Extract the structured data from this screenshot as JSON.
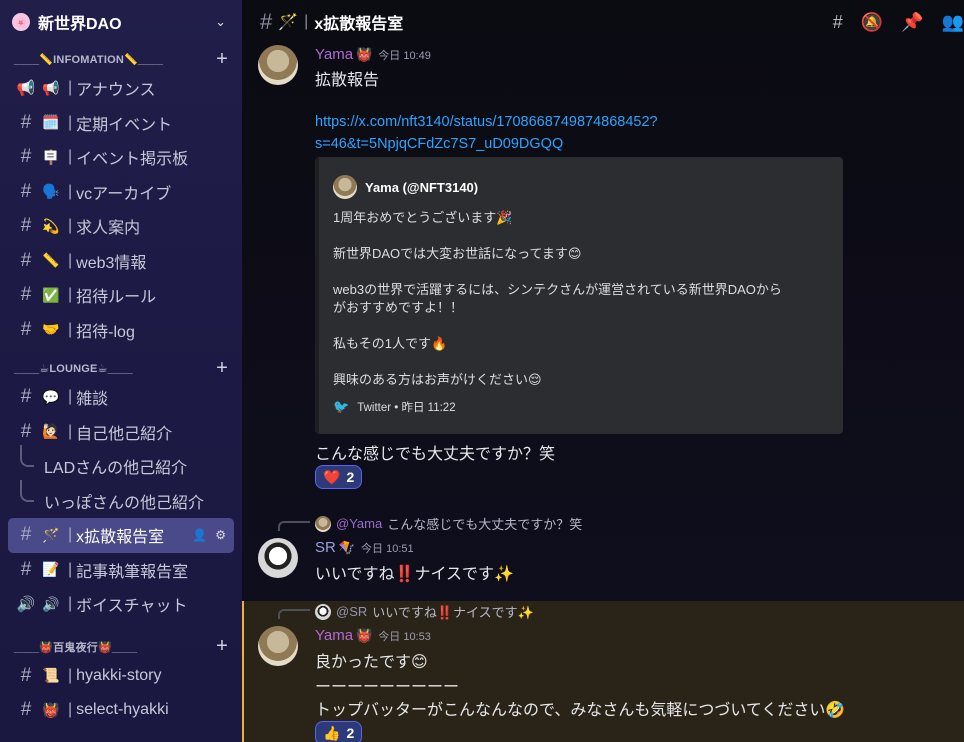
{
  "server": {
    "name": "新世界DAO",
    "icon": "🌸"
  },
  "categories": [
    {
      "label": "____📏INFOMATION📏____"
    },
    {
      "label": "____☕LOUNGE☕____"
    },
    {
      "label": "____👹百鬼夜行👹____"
    }
  ],
  "channels": {
    "info": [
      {
        "emoji": "📢",
        "name": "アナウンス",
        "icon": "announcement-icon"
      },
      {
        "emoji": "🗓️",
        "name": "定期イベント"
      },
      {
        "emoji": "🪧",
        "name": "イベント掲示板"
      },
      {
        "emoji": "🗣️",
        "name": "vcアーカイブ"
      },
      {
        "emoji": "💫",
        "name": "求人案内"
      },
      {
        "emoji": "📏",
        "name": "web3情報"
      },
      {
        "emoji": "✅",
        "name": "招待ルール"
      },
      {
        "emoji": "🤝",
        "name": "招待-log"
      }
    ],
    "lounge": [
      {
        "emoji": "💬",
        "name": "雑談"
      },
      {
        "emoji": "🙋🏻",
        "name": "自己他己紹介"
      },
      {
        "thread": "LADさんの他己紹介"
      },
      {
        "thread": "いっぽさんの他己紹介"
      },
      {
        "emoji": "🪄",
        "name": "x拡散報告室",
        "active": true
      },
      {
        "emoji": "📝",
        "name": "記事執筆報告室"
      },
      {
        "emoji": "🔊",
        "name": "ボイスチャット",
        "icon": "voice-icon"
      }
    ],
    "hyakki": [
      {
        "emoji": "📜",
        "name": "hyakki-story"
      },
      {
        "emoji": "👹",
        "name": "select-hyakki"
      }
    ]
  },
  "sep": "|",
  "topbar": {
    "emoji": "🪄",
    "title": "x拡散報告室"
  },
  "messages": {
    "m1": {
      "user": "Yama",
      "badge": "👹",
      "time": "今日 10:49",
      "text": "拡散報告",
      "link1": "https://x.com/nft3140/status/1708668749874868452?",
      "link2": "s=46&t=5NpjqCFdZc7S7_uD09DGQQ",
      "embed": {
        "author": "Yama (@NFT3140)",
        "lines": [
          "1周年おめでとうございます🎉",
          "",
          "新世界DAOでは大変お世話になってます😊",
          "",
          "web3の世界で活躍するには、シンテクさんが運営されている新世界DAOから",
          "がおすすめですよ！！",
          "",
          "私もその1人です🔥",
          "",
          "興味のある方はお声がけください😌"
        ],
        "footer": "Twitter • 昨日 11:22"
      },
      "followup": "こんな感じでも大丈夫ですか？笑",
      "reaction": {
        "emoji": "❤️",
        "count": "2"
      }
    },
    "m2": {
      "reply_mention": "@Yama",
      "reply_text": "こんな感じでも大丈夫ですか？笑",
      "user": "SR",
      "badge": "🪁",
      "time": "今日 10:51",
      "text": "いいですね‼️ナイスです✨"
    },
    "m3": {
      "reply_mention": "@SR",
      "reply_text": "いいですね‼️ナイスです✨",
      "user": "Yama",
      "badge": "👹",
      "time": "今日 10:53",
      "text": "良かったです😊",
      "line2": "ーーーーーーーーー",
      "line3": "トップバッターがこんなんなので、みなさんも気軽につづいてください🤣",
      "reaction": {
        "emoji": "👍",
        "count": "2"
      }
    }
  }
}
